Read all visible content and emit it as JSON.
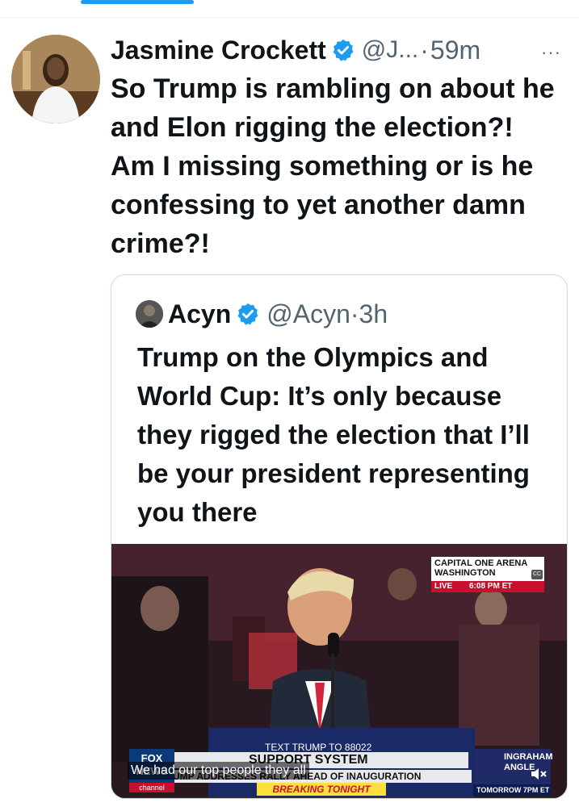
{
  "tweet": {
    "display_name": "Jasmine Crockett",
    "handle": "@J...",
    "separator": "·",
    "time": "59m",
    "more": "···",
    "text": "So Trump is rambling on about he and Elon rigging the election?! Am I missing something or is he confessing to yet another damn crime?!"
  },
  "quote": {
    "display_name": "Acyn",
    "handle": "@Acyn",
    "separator": "·",
    "time": "3h",
    "text": "Trump on the Olympics and World Cup: It’s only because they rigged the election that I’ll be your president representing you there"
  },
  "video": {
    "location": "CAPITAL ONE ARENA WASHINGTON",
    "live": "LIVE",
    "clock": "6:08 PM ET",
    "cc": "CC",
    "caption": "We had our top people they all",
    "headline": "SUPPORT SYSTEM",
    "subline": "TRUMP ADDRESSES RALLY AHEAD OF INAUGURATION",
    "breaking": "BREAKING TONIGHT",
    "network": "FOX NEWS",
    "network_channel": "channel",
    "show": "INGRAHAM ANGLE",
    "show_time": "TOMORROW 7PM ET",
    "podium_text": "TEXT TRUMP TO 88022"
  },
  "colors": {
    "verified_blue": "#1d9bf0",
    "accent_tab": "#1d9bf0",
    "secondary_text": "#536471"
  },
  "icons": [
    "verified-badge-icon",
    "more-icon",
    "mute-icon"
  ]
}
